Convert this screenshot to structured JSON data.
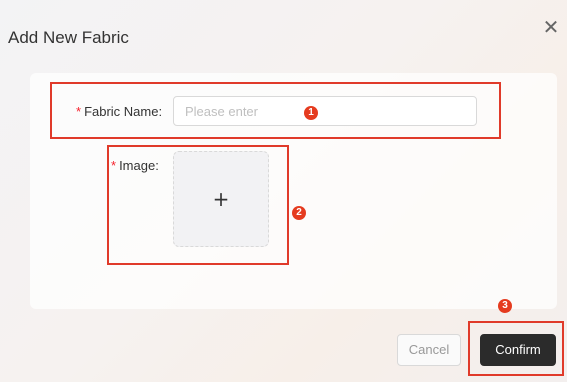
{
  "dialog": {
    "title": "Add New Fabric",
    "close_icon": "close-icon"
  },
  "form": {
    "fabric_name": {
      "required_mark": "*",
      "label": "Fabric Name",
      "colon": ":",
      "value": "",
      "placeholder": "Please enter"
    },
    "image": {
      "required_mark": "*",
      "label": "Image",
      "colon": ":",
      "upload_icon": "plus-icon",
      "upload_glyph": "+"
    }
  },
  "annotations": {
    "badge_1": "1",
    "badge_2": "2",
    "badge_3": "3",
    "highlight_color": "#e03a2a",
    "badge_color": "#e53b1f"
  },
  "footer": {
    "cancel_label": "Cancel",
    "confirm_label": "Confirm"
  }
}
